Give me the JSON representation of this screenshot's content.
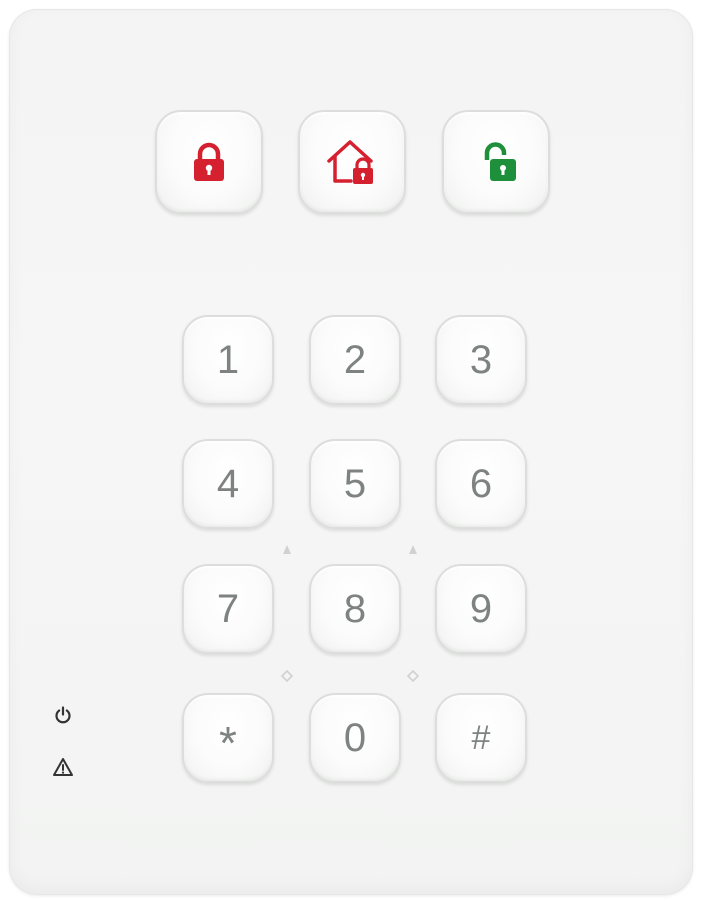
{
  "keypad": {
    "keys": [
      {
        "label": "1"
      },
      {
        "label": "2"
      },
      {
        "label": "3"
      },
      {
        "label": "4"
      },
      {
        "label": "5"
      },
      {
        "label": "6"
      },
      {
        "label": "7"
      },
      {
        "label": "8"
      },
      {
        "label": "9"
      },
      {
        "label": "*"
      },
      {
        "label": "0"
      },
      {
        "label": "#"
      }
    ]
  },
  "mode_buttons": [
    {
      "icon": "lock-icon",
      "color": "#d4202f"
    },
    {
      "icon": "home-lock-icon",
      "color": "#d4202f"
    },
    {
      "icon": "unlock-icon",
      "color": "#1e8f3a"
    }
  ],
  "indicators": [
    {
      "icon": "power-icon"
    },
    {
      "icon": "warning-icon"
    }
  ],
  "colors": {
    "body": "#f4f5f4",
    "key_text": "#7e8280",
    "arm_red": "#d4202f",
    "disarm_green": "#1e8f3a",
    "indicator": "#333333"
  }
}
